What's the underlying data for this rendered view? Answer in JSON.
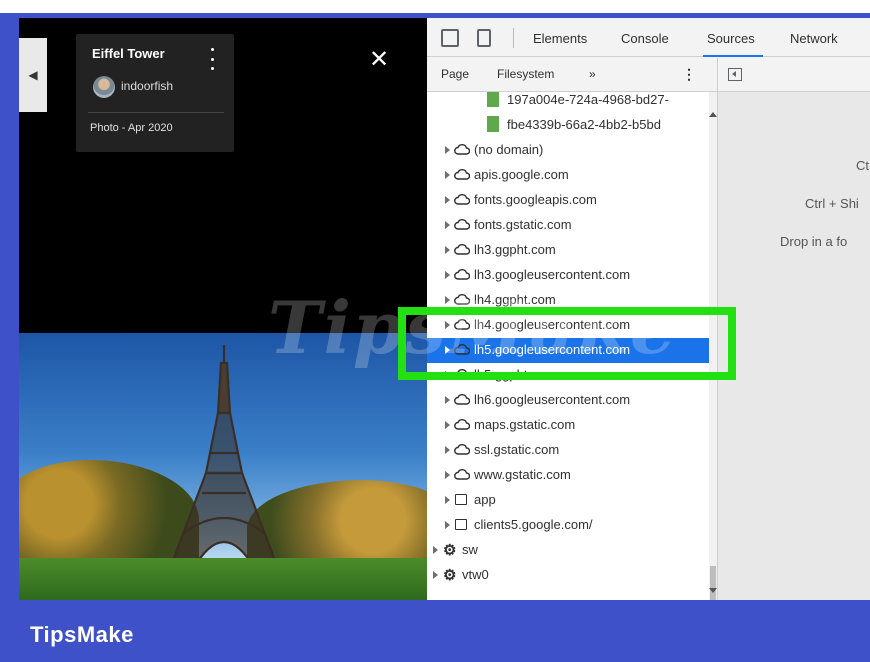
{
  "brand": {
    "name": "TipsMake",
    "background": "#3f51c8",
    "highlight_color": "#22e012"
  },
  "viewer": {
    "prev_icon": "chevron-left-icon",
    "info": {
      "title": "Eiffel Tower",
      "username": "indoorfish",
      "date": "Photo - Apr 2020"
    },
    "close_symbol": "✕",
    "watermark": "TipsMake"
  },
  "devtools": {
    "tabs": [
      "Elements",
      "Console",
      "Sources",
      "Network"
    ],
    "active_tab": "Sources",
    "navigator_tabs": [
      "Page",
      "Filesystem",
      "»"
    ],
    "tree": [
      {
        "label": "197a004e-724a-4968-bd27-",
        "type": "file",
        "indent": 4
      },
      {
        "label": "fbe4339b-66a2-4bb2-b5bd",
        "type": "file",
        "indent": 4
      },
      {
        "label": "(no domain)",
        "type": "cloud",
        "indent": 2
      },
      {
        "label": "apis.google.com",
        "type": "cloud",
        "indent": 2
      },
      {
        "label": "fonts.googleapis.com",
        "type": "cloud",
        "indent": 2
      },
      {
        "label": "fonts.gstatic.com",
        "type": "cloud",
        "indent": 2
      },
      {
        "label": "lh3.ggpht.com",
        "type": "cloud",
        "indent": 2
      },
      {
        "label": "lh3.googleusercontent.com",
        "type": "cloud",
        "indent": 2
      },
      {
        "label": "lh4.ggpht.com",
        "type": "cloud",
        "indent": 2
      },
      {
        "label": "lh4.googleusercontent.com",
        "type": "cloud",
        "indent": 2
      },
      {
        "label": "lh5.googleusercontent.com",
        "type": "cloud",
        "indent": 2,
        "selected": true
      },
      {
        "label": "lh5.ggpht.com",
        "type": "cloud",
        "indent": 2
      },
      {
        "label": "lh6.googleusercontent.com",
        "type": "cloud",
        "indent": 2
      },
      {
        "label": "maps.gstatic.com",
        "type": "cloud",
        "indent": 2
      },
      {
        "label": "ssl.gstatic.com",
        "type": "cloud",
        "indent": 2
      },
      {
        "label": "www.gstatic.com",
        "type": "cloud",
        "indent": 2
      },
      {
        "label": "app",
        "type": "folder",
        "indent": 2
      },
      {
        "label": "clients5.google.com/",
        "type": "folder",
        "indent": 2
      },
      {
        "label": "sw",
        "type": "worker",
        "indent": 0
      },
      {
        "label": "vtw0",
        "type": "worker",
        "indent": 0
      }
    ],
    "editor_hints": [
      "Ct",
      "Ctrl + Shi",
      "Drop in a fo"
    ]
  }
}
